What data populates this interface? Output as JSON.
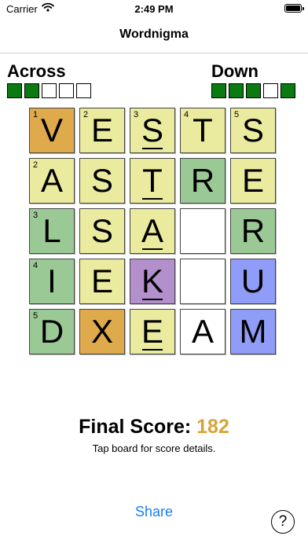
{
  "status": {
    "carrier": "Carrier",
    "time": "2:49 PM"
  },
  "nav": {
    "title": "Wordnigma"
  },
  "across": {
    "label": "Across",
    "boxes": [
      true,
      true,
      false,
      false,
      false
    ]
  },
  "down": {
    "label": "Down",
    "boxes": [
      true,
      true,
      true,
      false,
      true
    ]
  },
  "board": {
    "rows": [
      [
        {
          "letter": "V",
          "num": "1",
          "color": "#dfaa4c",
          "underline": false
        },
        {
          "letter": "E",
          "num": "2",
          "color": "#ebeb9f",
          "underline": false
        },
        {
          "letter": "S",
          "num": "3",
          "color": "#ebeb9f",
          "underline": true
        },
        {
          "letter": "T",
          "num": "4",
          "color": "#ebeb9f",
          "underline": false
        },
        {
          "letter": "S",
          "num": "5",
          "color": "#ebeb9f",
          "underline": false
        }
      ],
      [
        {
          "letter": "A",
          "num": "2",
          "color": "#ebeb9f",
          "underline": false
        },
        {
          "letter": "S",
          "num": "",
          "color": "#ebeb9f",
          "underline": false
        },
        {
          "letter": "T",
          "num": "",
          "color": "#ebeb9f",
          "underline": true
        },
        {
          "letter": "R",
          "num": "",
          "color": "#9bc996",
          "underline": false
        },
        {
          "letter": "E",
          "num": "",
          "color": "#ebeb9f",
          "underline": false
        }
      ],
      [
        {
          "letter": "L",
          "num": "3",
          "color": "#9bc996",
          "underline": false
        },
        {
          "letter": "S",
          "num": "",
          "color": "#ebeb9f",
          "underline": false
        },
        {
          "letter": "A",
          "num": "",
          "color": "#ebeb9f",
          "underline": true
        },
        {
          "letter": "",
          "num": "",
          "color": "#ffffff",
          "underline": false
        },
        {
          "letter": "R",
          "num": "",
          "color": "#9bc996",
          "underline": false
        }
      ],
      [
        {
          "letter": "I",
          "num": "4",
          "color": "#9bc996",
          "underline": false
        },
        {
          "letter": "E",
          "num": "",
          "color": "#ebeb9f",
          "underline": false
        },
        {
          "letter": "K",
          "num": "",
          "color": "#b38fcc",
          "underline": true
        },
        {
          "letter": "",
          "num": "",
          "color": "#ffffff",
          "underline": false
        },
        {
          "letter": "U",
          "num": "",
          "color": "#8f9cf8",
          "underline": false
        }
      ],
      [
        {
          "letter": "D",
          "num": "5",
          "color": "#9bc996",
          "underline": false
        },
        {
          "letter": "X",
          "num": "",
          "color": "#dfaa4c",
          "underline": false
        },
        {
          "letter": "E",
          "num": "",
          "color": "#ebeb9f",
          "underline": true
        },
        {
          "letter": "A",
          "num": "",
          "color": "#ffffff",
          "underline": false
        },
        {
          "letter": "M",
          "num": "",
          "color": "#8f9cf8",
          "underline": false
        }
      ]
    ]
  },
  "score": {
    "label": "Final Score:",
    "value": "182",
    "hint": "Tap board for score details."
  },
  "actions": {
    "share": "Share",
    "help": "?"
  }
}
